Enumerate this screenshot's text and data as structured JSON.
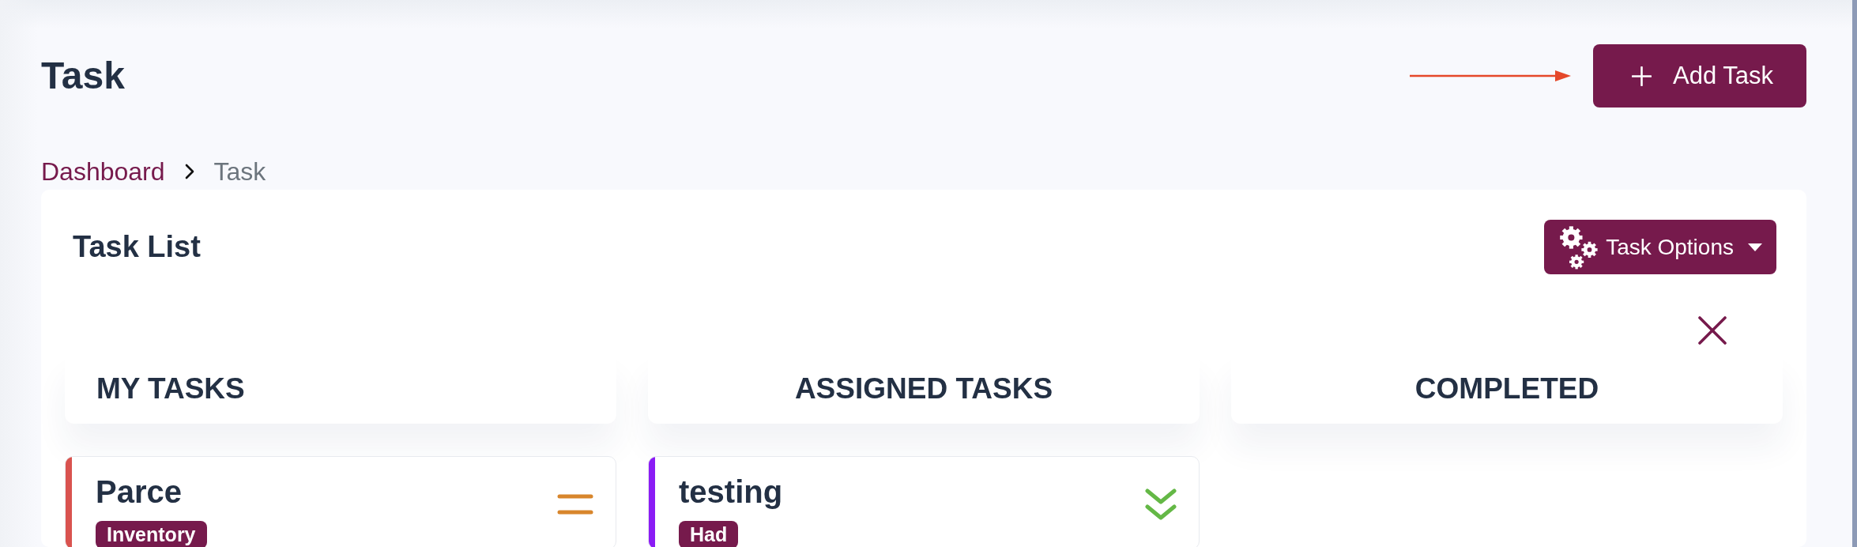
{
  "page": {
    "title": "Task"
  },
  "add_button": {
    "label": "Add Task"
  },
  "breadcrumb": [
    {
      "label": "Dashboard",
      "active": false
    },
    {
      "label": "Task",
      "active": true
    }
  ],
  "task_list": {
    "title": "Task List",
    "options_button": {
      "label": "Task Options"
    },
    "columns": [
      {
        "title": "MY TASKS",
        "tasks": [
          {
            "kind": "medium",
            "title": "Parce",
            "color": "#d9534f",
            "tag": "Inventory"
          }
        ]
      },
      {
        "title": "ASSIGNED TASKS",
        "tasks": [
          {
            "kind": "low",
            "title": "testing",
            "color": "#8b1cf5",
            "tag": "Had"
          }
        ]
      },
      {
        "title": "COMPLETED"
      }
    ]
  }
}
